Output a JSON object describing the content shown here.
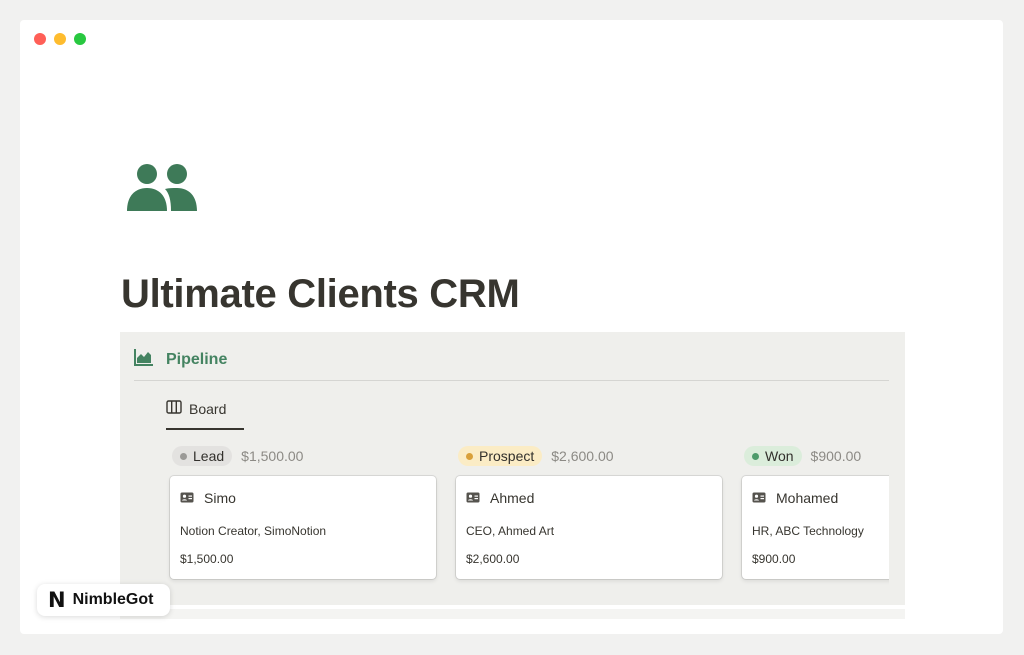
{
  "window": {
    "controls": [
      "close",
      "minimize",
      "zoom"
    ]
  },
  "page": {
    "icon": "people-icon",
    "title": "Ultimate Clients CRM"
  },
  "database": {
    "icon": "area-chart-icon",
    "title": "Pipeline",
    "views": [
      {
        "icon": "board-icon",
        "label": "Board",
        "active": true
      }
    ],
    "columns": [
      {
        "status": "Lead",
        "color": "#9b9a97",
        "pill_bg": "#e3e2e0",
        "sum": "$1,500.00",
        "cards": [
          {
            "icon": "contact-card-icon",
            "name": "Simo",
            "role": "Notion Creator, SimoNotion",
            "amount": "$1,500.00"
          }
        ]
      },
      {
        "status": "Prospect",
        "color": "#d9a03a",
        "pill_bg": "#fbecc5",
        "sum": "$2,600.00",
        "cards": [
          {
            "icon": "contact-card-icon",
            "name": "Ahmed",
            "role": "CEO, Ahmed Art",
            "amount": "$2,600.00"
          }
        ]
      },
      {
        "status": "Won",
        "color": "#4e9b6b",
        "pill_bg": "#dbeddb",
        "sum": "$900.00",
        "cards": [
          {
            "icon": "contact-card-icon",
            "name": "Mohamed",
            "role": "HR, ABC Technology",
            "amount": "$900.00"
          }
        ]
      }
    ]
  },
  "watermark": {
    "logo": "N",
    "text": "NimbleGot"
  },
  "colors": {
    "accent_green": "#448361",
    "icon_green": "#3e7a58"
  }
}
